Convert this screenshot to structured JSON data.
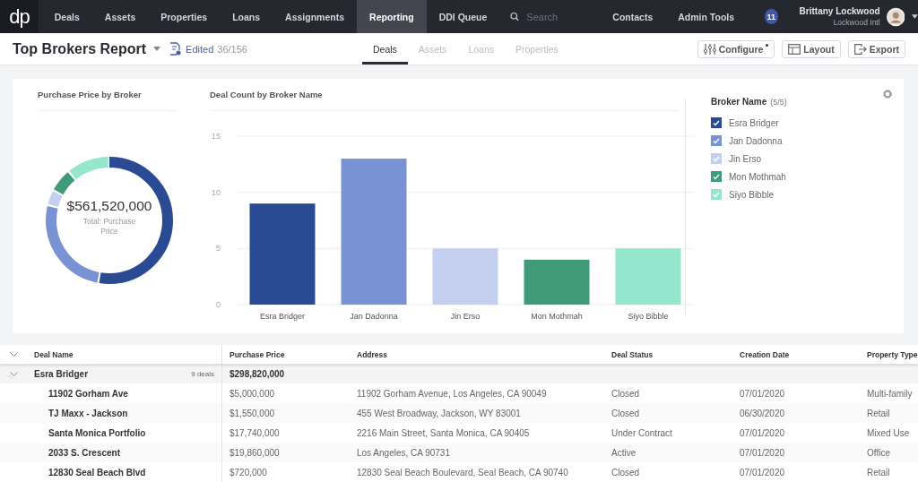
{
  "nav": {
    "logo": "dp",
    "items": [
      {
        "label": "Deals",
        "selected": false
      },
      {
        "label": "Assets",
        "selected": false
      },
      {
        "label": "Properties",
        "selected": false
      },
      {
        "label": "Loans",
        "selected": false
      },
      {
        "label": "Assignments",
        "selected": false
      },
      {
        "label": "Reporting",
        "selected": true
      },
      {
        "label": "DDI Queue",
        "selected": false
      }
    ],
    "search": {
      "placeholder": "Search"
    },
    "links": [
      "Contacts",
      "Admin Tools"
    ],
    "badge": "11",
    "user": {
      "name": "Brittany Lockwood",
      "company": "Lockwood Intl"
    }
  },
  "report": {
    "title": "Top Brokers Report",
    "edited_label": "Edited",
    "edited_count": "36/156",
    "tabs": [
      {
        "label": "Deals",
        "selected": true
      },
      {
        "label": "Assets",
        "selected": false
      },
      {
        "label": "Loans",
        "selected": false
      },
      {
        "label": "Properties",
        "selected": false
      }
    ],
    "buttons": [
      {
        "label": "Configure",
        "kind": "configure"
      },
      {
        "label": "Layout",
        "kind": "layout"
      },
      {
        "label": "Export",
        "kind": "export"
      }
    ]
  },
  "donut": {
    "title": "Purchase Price by Broker",
    "total": "$561,520,000",
    "caption": "Total: Purchase Price"
  },
  "bar_chart": {
    "title": "Deal Count by Broker Name",
    "chart_data": {
      "type": "bar",
      "categories": [
        "Esra Bridger",
        "Jan Dadonna",
        "Jin Erso",
        "Mon Mothmah",
        "Siyo Bibble"
      ],
      "values": [
        9,
        13,
        5,
        4,
        5
      ],
      "ylim": [
        0,
        15
      ],
      "yticks": [
        0,
        5,
        10,
        15
      ]
    }
  },
  "legend": {
    "title": "Broker Name",
    "count": "(5/5)",
    "items": [
      {
        "label": "Esra Bridger",
        "checked": true,
        "color": "#2b4a94"
      },
      {
        "label": "Jan Dadonna",
        "checked": true,
        "color": "#7892d4"
      },
      {
        "label": "Jin Erso",
        "checked": true,
        "color": "#c5d0f0"
      },
      {
        "label": "Mon Mothmah",
        "checked": true,
        "color": "#3e9a78"
      },
      {
        "label": "Siyo Bibble",
        "checked": true,
        "color": "#94e6cc"
      }
    ]
  },
  "table": {
    "columns": [
      "Deal Name",
      "Purchase Price",
      "Address",
      "Deal Status",
      "Creation Date",
      "Property Type"
    ],
    "group": {
      "name": "Esra Bridger",
      "count": "9 deals",
      "total": "$298,820,000",
      "expanded": true
    },
    "rows": [
      [
        "11902 Gorham Ave",
        "$5,000,000",
        "11902 Gorham Avenue, Los Angeles, CA 90049",
        "Closed",
        "07/01/2020",
        "Multi-family"
      ],
      [
        "TJ Maxx - Jackson",
        "$1,550,000",
        "455 West Broadway, Jackson, WY 83001",
        "Closed",
        "06/30/2020",
        "Retail"
      ],
      [
        "Santa Monica Portfolio",
        "$17,740,000",
        "2216 Main Street, Santa Monica, CA 90405",
        "Under Contract",
        "07/01/2020",
        "Mixed Use"
      ],
      [
        "2033 S. Crescent",
        "$19,860,000",
        "Los Angeles, CA 90731",
        "Active",
        "07/01/2020",
        "Office"
      ],
      [
        "12830 Seal Beach Blvd",
        "$720,000",
        "12830 Seal Beach Boulevard, Seal Beach, CA 90740",
        "Closed",
        "07/01/2020",
        "Retail"
      ]
    ]
  }
}
